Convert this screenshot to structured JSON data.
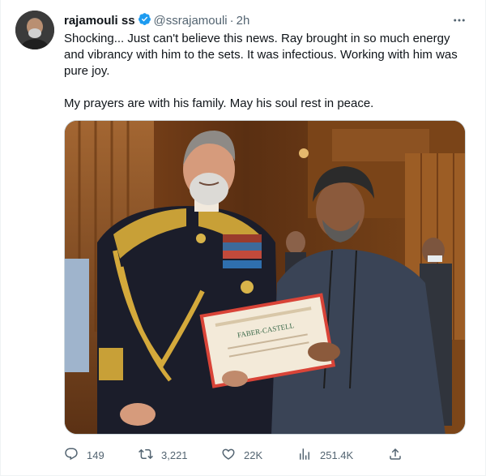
{
  "tweet": {
    "display_name": "rajamouli ss",
    "handle": "@ssrajamouli",
    "separator": "·",
    "time": "2h",
    "paragraphs": [
      "Shocking... Just can't believe this news. Ray brought in so much energy and vibrancy with him to the sets. It was infectious. Working with him was pure joy.",
      "My prayers are with his family. May his soul rest in peace."
    ],
    "photo": {
      "folder_brand": "FABER-CASTELL"
    },
    "actions": {
      "replies": "149",
      "retweets": "3,221",
      "likes": "22K",
      "views": "251.4K"
    },
    "icons": {
      "verified": "verified-badge-icon",
      "more": "more-icon",
      "reply": "reply-icon",
      "retweet": "retweet-icon",
      "like": "heart-icon",
      "views": "views-icon",
      "share": "share-icon"
    },
    "colors": {
      "verified": "#1d9bf0",
      "secondary_text": "#536471",
      "primary_text": "#0f1419"
    }
  }
}
